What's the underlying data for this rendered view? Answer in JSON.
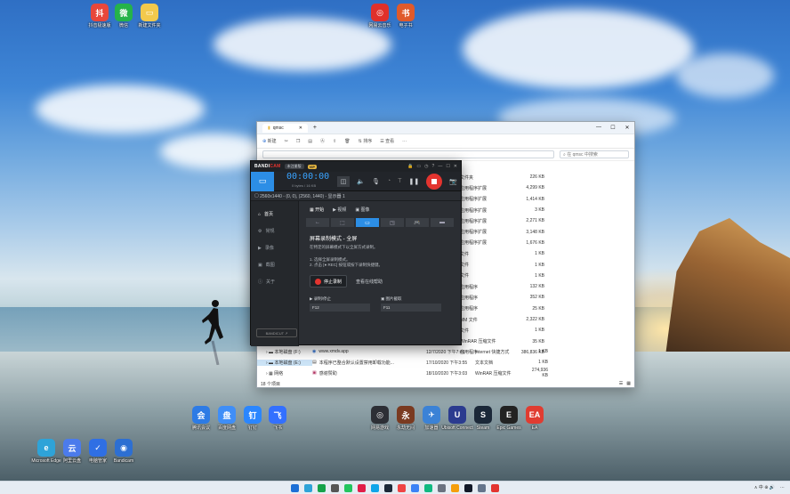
{
  "desktop": {
    "top_icons": [
      {
        "label": "抖音极速版",
        "color": "#e8473b",
        "glyph": "抖"
      },
      {
        "label": "微信",
        "color": "#25b34a",
        "glyph": "微"
      },
      {
        "label": "新建文件夹",
        "color": "#f2c94c",
        "glyph": "▭"
      },
      {
        "label": "网易云音乐",
        "color": "#e0302a",
        "glyph": "◎"
      },
      {
        "label": "电子书",
        "color": "#e05a2b",
        "glyph": "书"
      }
    ],
    "middle_icons": [
      {
        "label": "腾讯会议",
        "color": "#2d7be5",
        "glyph": "会"
      },
      {
        "label": "百度网盘",
        "color": "#3f8ef7",
        "glyph": "盘"
      },
      {
        "label": "钉钉",
        "color": "#2a86ff",
        "glyph": "钉"
      },
      {
        "label": "飞书",
        "color": "#3370ff",
        "glyph": "飞"
      }
    ],
    "left_icons": [
      {
        "label": "Microsoft Edge",
        "color": "#2ea3d8",
        "glyph": "e"
      },
      {
        "label": "阿里云盘",
        "color": "#4b7bec",
        "glyph": "云"
      },
      {
        "label": "电脑管家",
        "color": "#2f6fe4",
        "glyph": "✓"
      },
      {
        "label": "Bandicam",
        "color": "#2d6fd2",
        "glyph": "◉"
      }
    ],
    "game_icons": [
      {
        "label": "网易游戏",
        "color": "#2d2f35",
        "glyph": "◎"
      },
      {
        "label": "永劫无间",
        "color": "#7a3a20",
        "glyph": "永"
      },
      {
        "label": "加速器",
        "color": "#3b82d6",
        "glyph": "✈"
      },
      {
        "label": "Ubisoft Connect",
        "color": "#2b3b8f",
        "glyph": "U"
      },
      {
        "label": "Steam",
        "color": "#1b2838",
        "glyph": "S"
      },
      {
        "label": "Epic Games",
        "color": "#222",
        "glyph": "E"
      },
      {
        "label": "EA",
        "color": "#e03c31",
        "glyph": "EA"
      }
    ]
  },
  "explorer": {
    "tab_title": "qmsc",
    "toolbar": [
      "新建",
      "排序",
      "查看",
      "···"
    ],
    "search_placeholder": "在 qmsc 中搜索",
    "right_rows": [
      {
        "type": "文件夹",
        "size": "226 KB"
      },
      {
        "type": "应用程序扩展",
        "size": "4,299 KB"
      },
      {
        "type": "应用程序扩展",
        "size": "1,414 KB"
      },
      {
        "type": "应用程序扩展",
        "size": "3 KB"
      },
      {
        "type": "应用程序扩展",
        "size": "2,271 KB"
      },
      {
        "type": "应用程序扩展",
        "size": "3,148 KB"
      },
      {
        "type": "应用程序扩展",
        "size": "1,676 KB"
      },
      {
        "type": "文件",
        "size": "1 KB"
      },
      {
        "type": "文件",
        "size": "1 KB"
      },
      {
        "type": "文件",
        "size": "1 KB"
      },
      {
        "type": "应用程序",
        "size": "132 KB"
      },
      {
        "type": "应用程序",
        "size": "352 KB"
      },
      {
        "type": "应用程序",
        "size": "25 KB"
      },
      {
        "type": "MM 文件",
        "size": "2,322 KB"
      },
      {
        "type": "文件",
        "size": "1 KB"
      },
      {
        "type": "WinRAR 压缩文件",
        "size": "35 KB"
      },
      {
        "type": "应用程序",
        "size": "386,836 KB"
      }
    ],
    "bottom_rows": [
      {
        "nav": "本地磁盘 (F:)",
        "name": "www.xmdv.app",
        "date": "12/7/2020 下午7:46",
        "type": "Internet 快捷方式",
        "size": "1 KB"
      },
      {
        "nav": "本地磁盘 (E:)",
        "name": "本程序已整合默认设置禁用卸载功能...",
        "date": "17/10/2020 下午3:55",
        "type": "文本文档",
        "size": "1 KB"
      },
      {
        "nav": "网络",
        "name": "感谢赞助",
        "date": "18/10/2020 下午3:03",
        "type": "WinRAR 压缩文件",
        "size": "274,936 KB"
      }
    ],
    "status": "18 个项目"
  },
  "bandicam": {
    "logo_a": "BANDI",
    "logo_b": "CAM",
    "edition": "未注册版",
    "vip": "VIP",
    "timer": "00:00:00",
    "size": "0 bytes / 16 KB",
    "info": "2560x1440 - (0, 0), (2560, 1440) - 显示器 1",
    "sidebar": [
      "首页",
      "常规",
      "录像",
      "截图",
      "关于"
    ],
    "bdcut": "BANDICUT ↗",
    "tabs": [
      "开始",
      "视频",
      "图像"
    ],
    "mode_title": "屏幕录制模式 - 全屏",
    "mode_desc": "在特定的屏幕模式下以全屏方式录制。",
    "steps": [
      "1. 选择全屏录制模式。",
      "2. 点击 [● REC] 按钮或按下录制快捷键。"
    ],
    "start_btn": "停止录制",
    "help_link": "查看在线帮助",
    "key_record_label": "录制/停止",
    "key_record_value": "F12",
    "key_capture_label": "图片截取",
    "key_capture_value": "F11"
  },
  "taskbar": {
    "colors": [
      "#1c6fd6",
      "#2ea3d8",
      "#16a34a",
      "#555",
      "#22c55e",
      "#e11d48",
      "#0ea5e9",
      "#1b2838",
      "#ef4444",
      "#3b82f6",
      "#10b981",
      "#6b7280",
      "#f59e0b",
      "#111827",
      "#64748b",
      "#e3342f"
    ],
    "tray_text": "∧ 中 ⊕ 🔊",
    "time": "⋯"
  }
}
